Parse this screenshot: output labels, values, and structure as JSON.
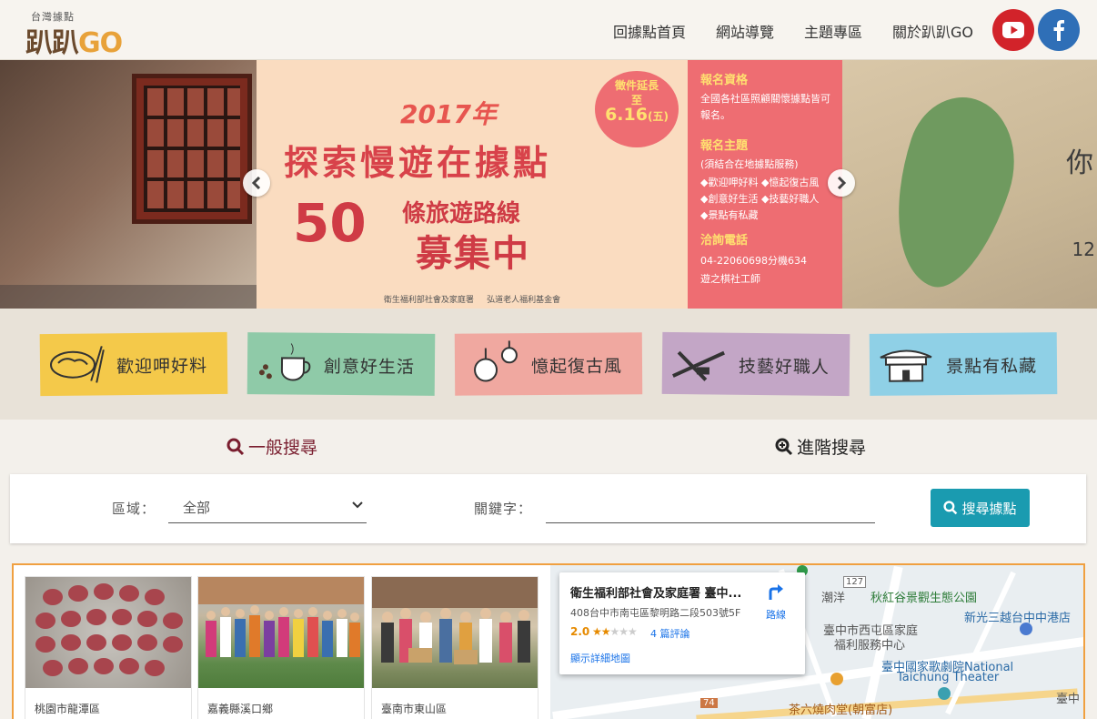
{
  "header": {
    "logo_small": "台灣據點",
    "logo_main": "趴趴",
    "logo_go": "GO",
    "nav": [
      "回據點首頁",
      "網站導覽",
      "主題專區",
      "關於趴趴GO"
    ]
  },
  "carousel": {
    "year_title": "2017年",
    "title": "探索慢遊在據點",
    "number": "50",
    "subtitle_small": "條旅遊路線",
    "subtitle_big": "募集中",
    "deadline_line1": "徵件延長",
    "deadline_line2": "至",
    "deadline_date": "6.16",
    "deadline_day": "(五)",
    "panel": [
      {
        "heading": "報名資格",
        "body": "全國各社區照顧關懷據點皆可報名。"
      },
      {
        "heading": "報名主題",
        "body": "(須結合在地據點服務)"
      },
      {
        "heading": "",
        "body": "◆歡迎呷好料 ◆憶起復古風"
      },
      {
        "heading": "",
        "body": "◆創意好生活 ◆技藝好職人"
      },
      {
        "heading": "",
        "body": "◆景點有私藏"
      },
      {
        "heading": "洽詢電話",
        "body": "04-22060698分機634"
      },
      {
        "heading": "",
        "body": "遊之棋社工師"
      }
    ],
    "footer_left": "衛生福利部社會及家庭署",
    "footer_right": "弘道老人福利基金會",
    "right_number": "12",
    "right_char": "你"
  },
  "categories": [
    {
      "label": "歡迎呷好料",
      "color": "#f4c94a"
    },
    {
      "label": "創意好生活",
      "color": "#8fcaa8"
    },
    {
      "label": "憶起復古風",
      "color": "#f0a8a0"
    },
    {
      "label": "技藝好職人",
      "color": "#c3a6c6"
    },
    {
      "label": "景點有私藏",
      "color": "#8fd0e6"
    }
  ],
  "search": {
    "tab_general": "一般搜尋",
    "tab_advanced": "進階搜尋",
    "region_label": "區域：",
    "region_value": "全部",
    "keyword_label": "關鍵字：",
    "keyword_value": "",
    "button_label": "搜尋據點"
  },
  "results": [
    {
      "caption": "桃園市龍潭區"
    },
    {
      "caption": "嘉義縣溪口鄉"
    },
    {
      "caption": "臺南市東山區"
    }
  ],
  "map": {
    "info_title": "衛生福利部社會及家庭署 臺中...",
    "info_address": "408台中市南屯區黎明路二段503號5F",
    "rating": "2.0",
    "stars_on": 2,
    "reviews": "4 篇評論",
    "more_link": "顯示詳細地圖",
    "directions": "路線",
    "labels": [
      "潮洋",
      "秋紅谷景觀生態公園",
      "新光三越台中中港店",
      "臺中市西屯區家庭",
      "福利服務中心",
      "臺中國家歌劇院National",
      "Taichung Theater",
      "茶六燒肉堂(朝富店)",
      "臺中",
      "127",
      "74"
    ]
  },
  "colors": {
    "accent": "#1a9bb0",
    "tab_active": "#7a1e2f",
    "youtube": "#d2232a",
    "facebook": "#2f6fb7",
    "results_border": "#f0a040"
  }
}
